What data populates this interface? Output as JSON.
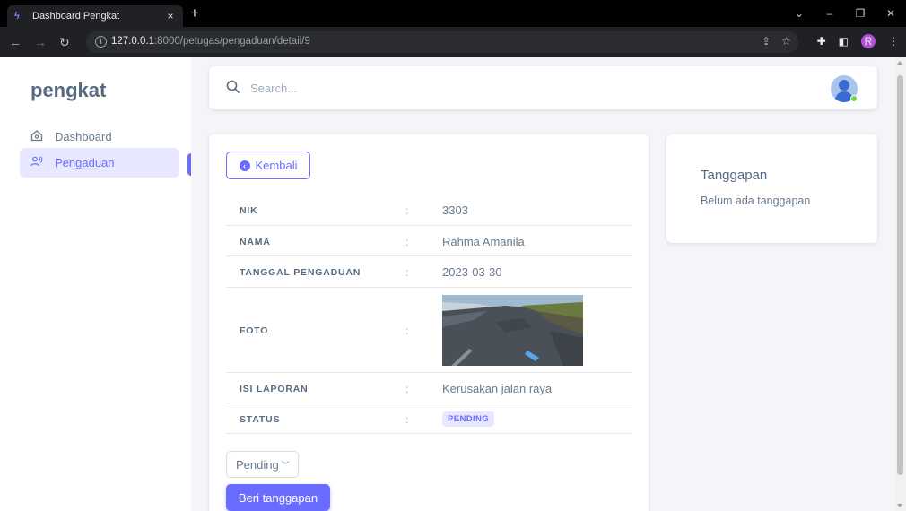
{
  "browser": {
    "tab_title": "Dashboard Pengkat",
    "tab_close": "×",
    "new_tab": "+",
    "url_host": "127.0.0.1",
    "url_rest": ":8000/petugas/pengaduan/detail/9",
    "profile_initial": "R"
  },
  "sidebar": {
    "brand": "pengkat",
    "items": [
      {
        "label": "Dashboard",
        "icon": "home-icon",
        "active": false
      },
      {
        "label": "Pengaduan",
        "icon": "users-icon",
        "active": true
      }
    ]
  },
  "search": {
    "placeholder": "Search..."
  },
  "detail": {
    "back_label": "Kembali",
    "colon": ":",
    "rows": [
      {
        "label": "NIK",
        "value": "3303"
      },
      {
        "label": "NAMA",
        "value": "Rahma Amanila"
      },
      {
        "label": "TANGGAL PENGADUAN",
        "value": "2023-03-30"
      },
      {
        "label": "FOTO",
        "value": "",
        "icon": "road-damage-photo"
      },
      {
        "label": "ISI LAPORAN",
        "value": "Kerusakan jalan raya"
      },
      {
        "label": "STATUS",
        "value": "PENDING"
      }
    ],
    "select_value": "Pending",
    "submit_label": "Beri tanggapan"
  },
  "response_panel": {
    "title": "Tanggapan",
    "empty_text": "Belum ada tanggapan"
  },
  "colors": {
    "primary": "#696cff",
    "primary_light": "#e7e7ff",
    "text": "#697a8d",
    "heading": "#566a7f",
    "online": "#71dd37"
  }
}
